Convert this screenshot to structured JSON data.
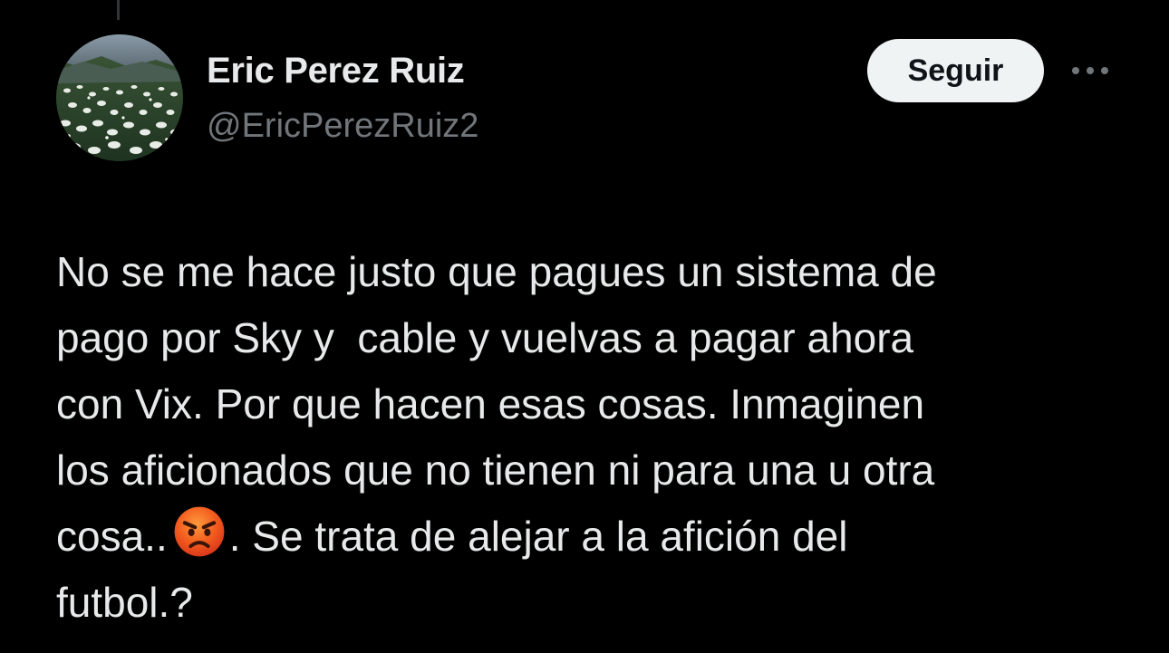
{
  "tweet": {
    "author": {
      "name": "Eric Perez Ruiz",
      "handle": "@EricPerezRuiz2"
    },
    "follow_label": "Seguir",
    "more_icon": "more-horizontal-icon",
    "text": {
      "line1": "No se me hace justo que pagues un sistema de",
      "line2": "pago por Sky y  cable y vuelvas a pagar ahora",
      "line3": "con Vix. Por que hacen esas cosas. Inmaginen",
      "line4": "los aficionados que no tienen ni para una u otra",
      "line5_before_emoji": "cosa..",
      "emoji": "angry-face-emoji",
      "line5_after_emoji": ". Se trata de alejar a la afición del",
      "line6": "futbol.?"
    }
  },
  "colors": {
    "background": "#000000",
    "primary_text": "#e7e9ea",
    "secondary_text": "#71767b",
    "follow_button_bg": "#eff3f4",
    "follow_button_text": "#0f1419",
    "thread_line": "#333639"
  }
}
